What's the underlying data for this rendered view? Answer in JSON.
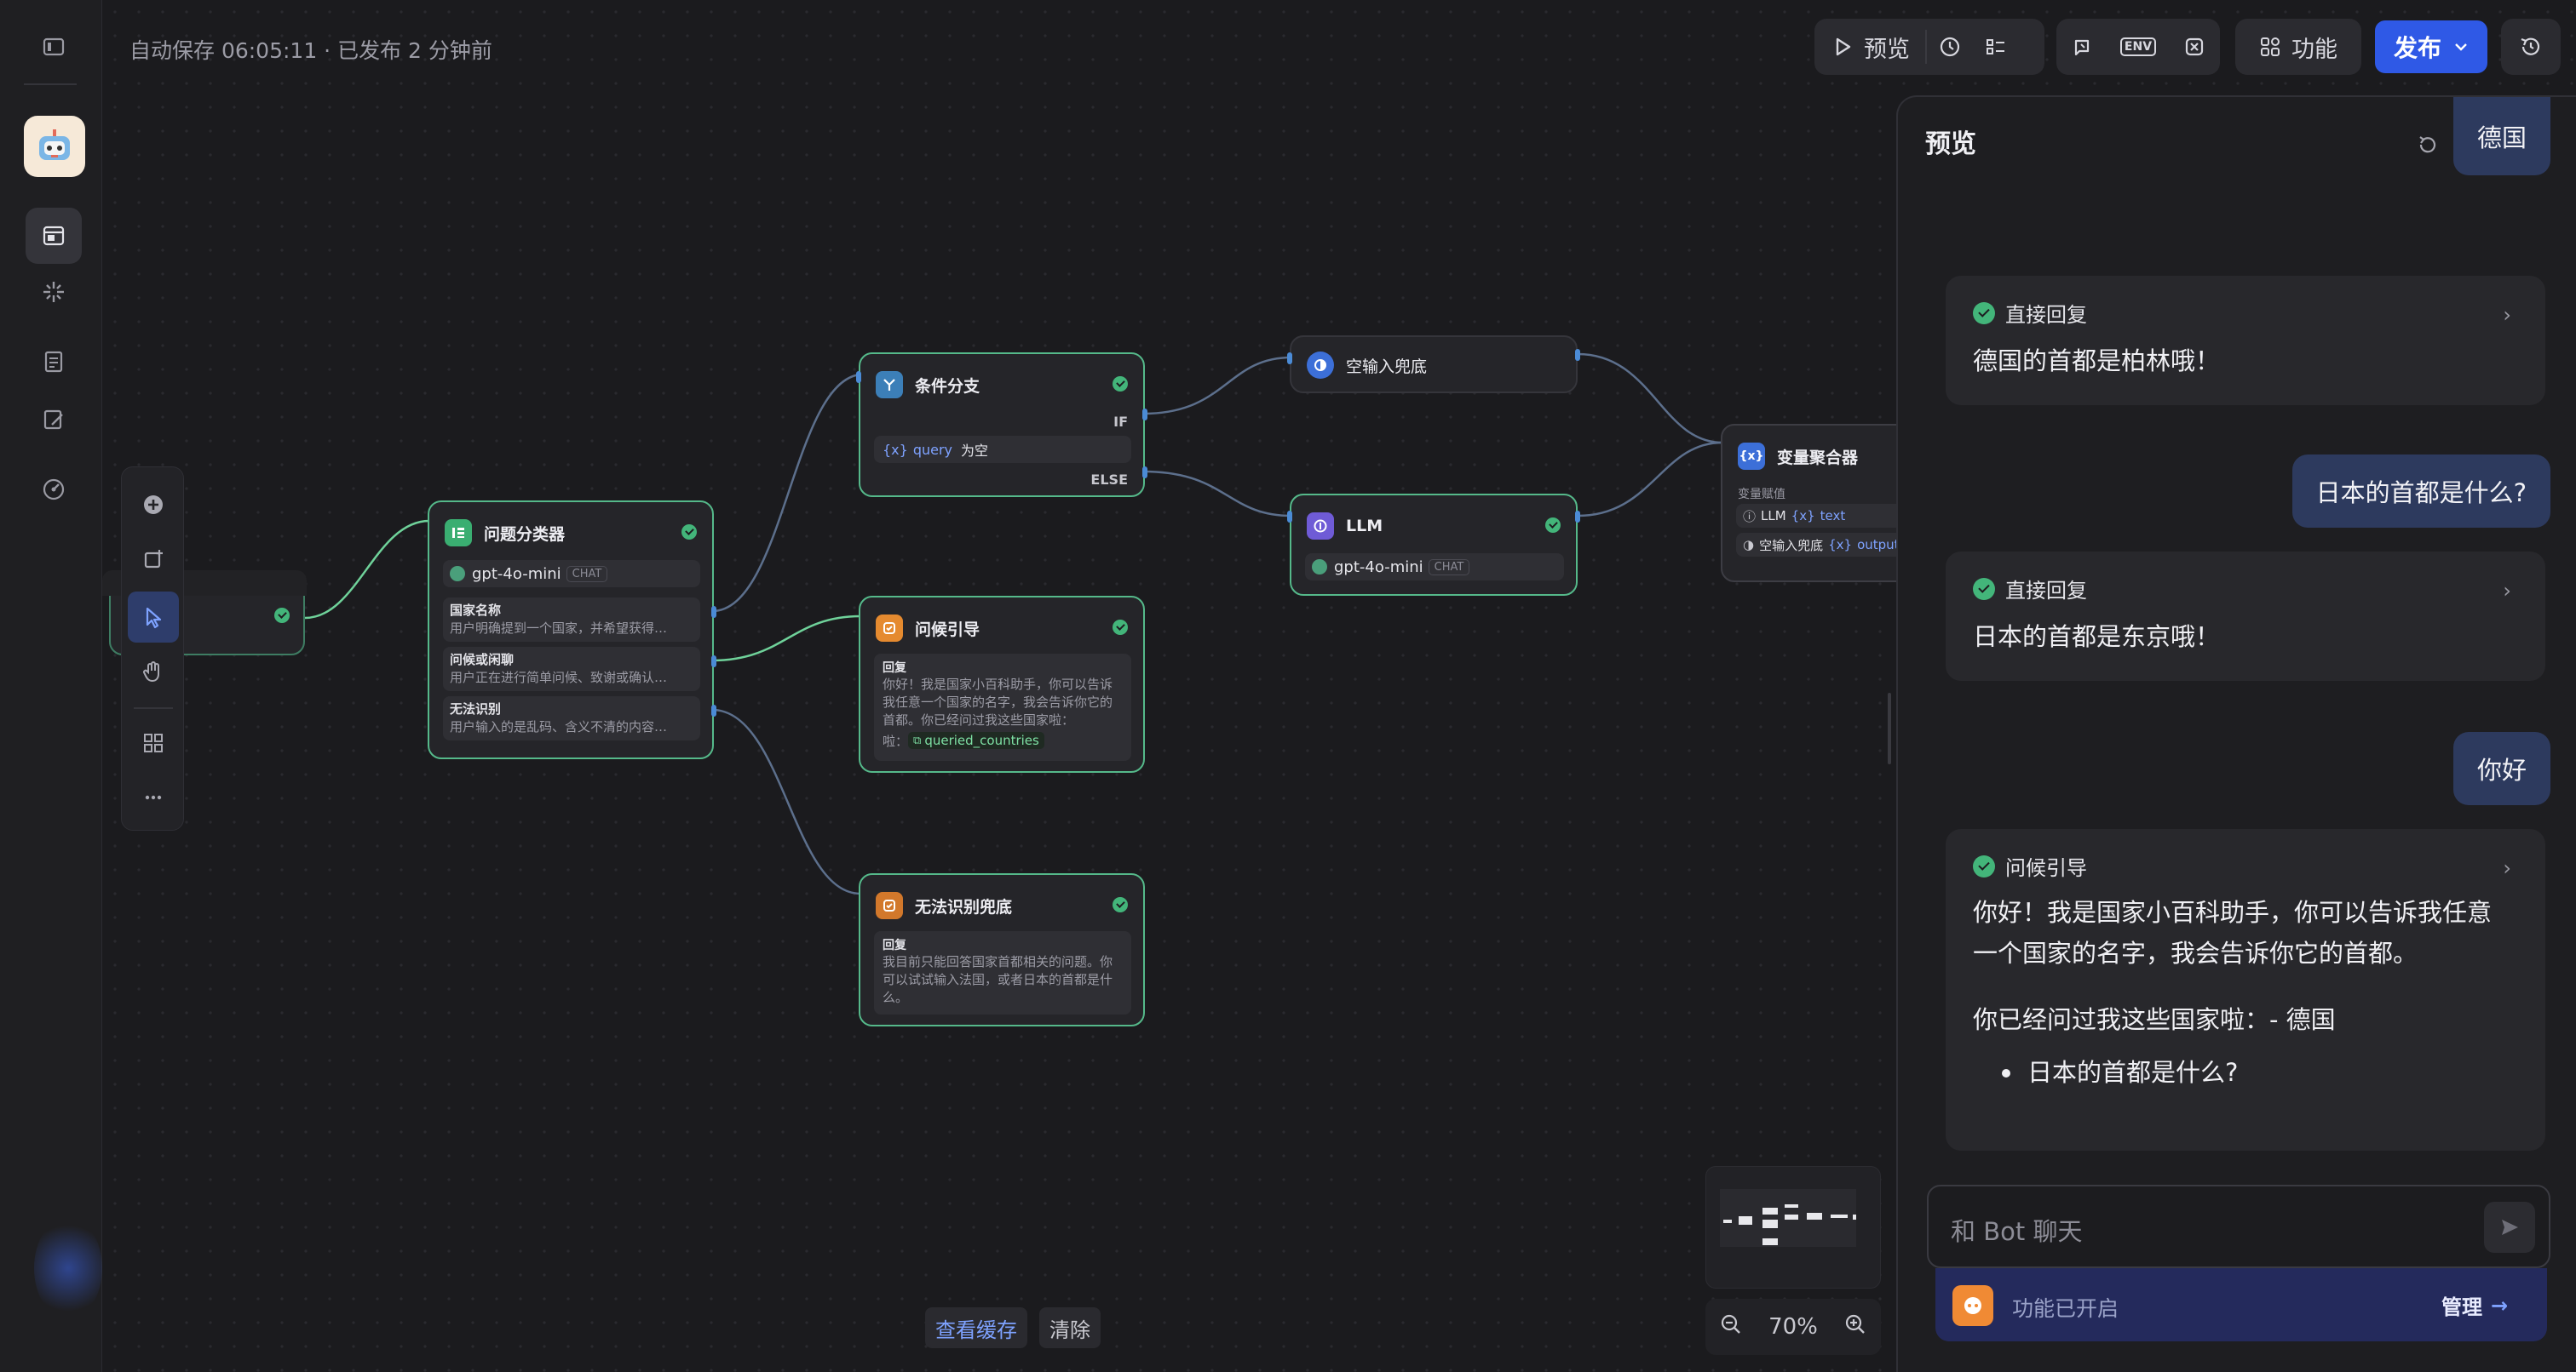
{
  "header": {
    "autosave": "自动保存 06:05:11 · 已发布 2 分钟前",
    "preview_label": "预览",
    "feature_label": "功能",
    "publish_label": "发布",
    "env_label": "ENV"
  },
  "nodes": {
    "classifier": {
      "title": "问题分类器",
      "model": "gpt-4o-mini",
      "model_tag": "CHAT",
      "classes": [
        {
          "name": "国家名称",
          "desc": "用户明确提到一个国家，并希望获得…"
        },
        {
          "name": "问候或闲聊",
          "desc": "用户正在进行简单问候、致谢或确认…"
        },
        {
          "name": "无法识别",
          "desc": "用户输入的是乱码、含义不清的内容…"
        }
      ]
    },
    "condition": {
      "title": "条件分支",
      "if": "IF",
      "var": "query",
      "op": "为空",
      "else": "ELSE"
    },
    "empty_fallback": {
      "title": "空输入兜底"
    },
    "llm": {
      "title": "LLM",
      "model": "gpt-4o-mini",
      "model_tag": "CHAT"
    },
    "greeting": {
      "title": "问候引导",
      "reply_label": "回复",
      "reply_text": "你好！我是国家小百科助手，你可以告诉我任意一个国家的名字，我会告诉你它的首都。你已经问过我这些国家啦：",
      "variable": "queried_countries"
    },
    "unknown": {
      "title": "无法识别兜底",
      "reply_label": "回复",
      "reply_text": "我目前只能回答国家首都相关的问题。你可以试试输入法国，或者日本的首都是什么。"
    },
    "aggregator": {
      "title": "变量聚合器",
      "sub_label": "变量赋值",
      "items": [
        {
          "src": "LLM",
          "var": "text"
        },
        {
          "src": "空输入兜底",
          "var": "output"
        }
      ]
    }
  },
  "preview": {
    "title": "预览",
    "messages": [
      {
        "role": "user",
        "text": "德国"
      },
      {
        "role": "bot",
        "node": "直接回复",
        "text": "德国的首都是柏林哦！"
      },
      {
        "role": "user",
        "text": "日本的首都是什么?"
      },
      {
        "role": "bot",
        "node": "直接回复",
        "text": "日本的首都是东京哦！"
      },
      {
        "role": "user",
        "text": "你好"
      },
      {
        "role": "bot",
        "node": "问候引导",
        "lines": [
          "你好！我是国家小百科助手，你可以告诉我任意",
          "一个国家的名字，我会告诉你它的首都。",
          "你已经问过我这些国家啦：- 德国",
          "日本的首都是什么?"
        ]
      }
    ],
    "input_placeholder": "和 Bot 聊天",
    "feature_status": "功能已开启",
    "manage_label": "管理"
  },
  "canvas_controls": {
    "view_cache": "查看缓存",
    "clear": "清除",
    "zoom": "70%"
  },
  "colors": {
    "accent": "#2f59e6",
    "node_border": "#55b98a",
    "success": "#43b57a",
    "edge": "#5c6f8c"
  }
}
